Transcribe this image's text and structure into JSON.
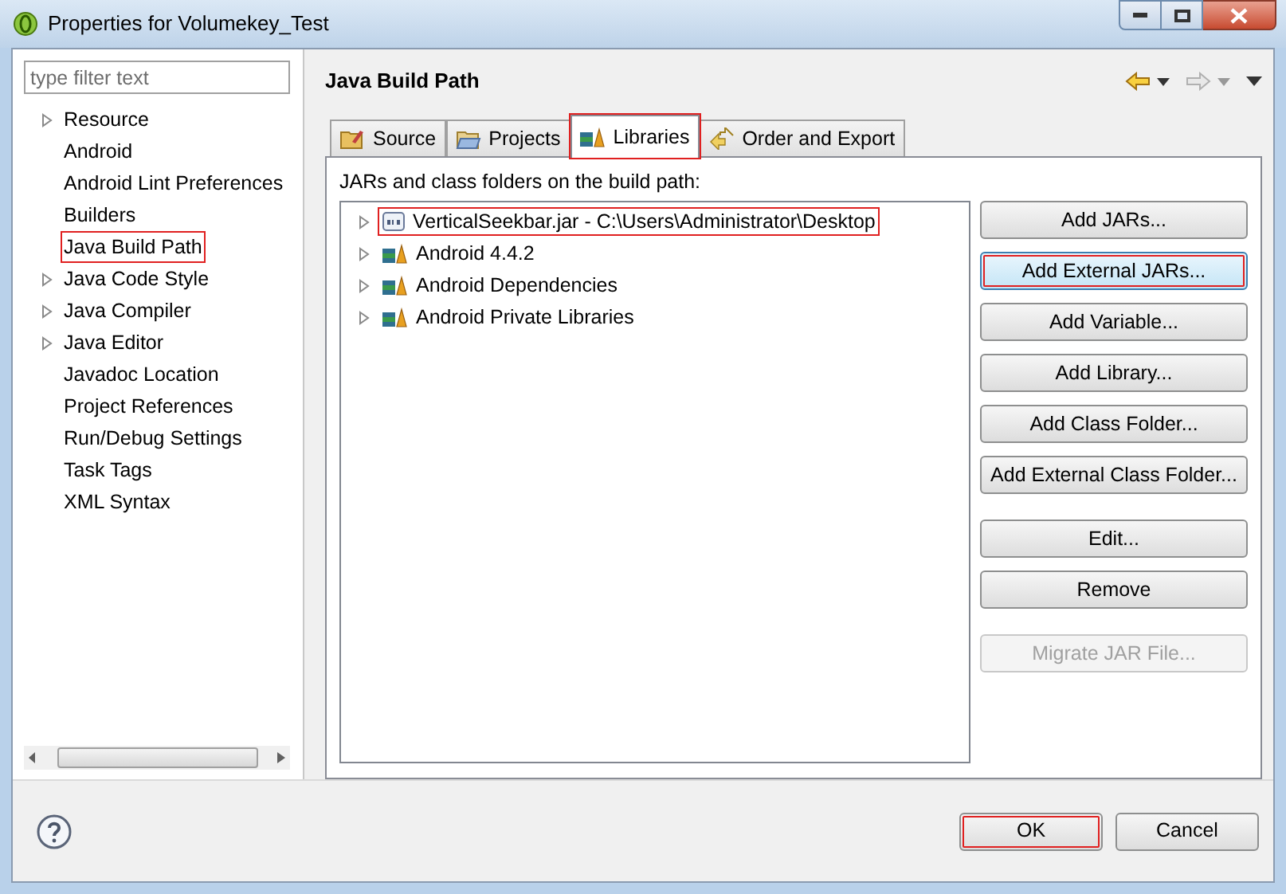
{
  "window": {
    "title": "Properties for Volumekey_Test"
  },
  "sidebar": {
    "filter": {
      "placeholder": "type filter text"
    },
    "items": [
      {
        "label": "Resource",
        "expandable": true,
        "highlighted": false
      },
      {
        "label": "Android",
        "expandable": false,
        "highlighted": false
      },
      {
        "label": "Android Lint Preferences",
        "expandable": false,
        "highlighted": false
      },
      {
        "label": "Builders",
        "expandable": false,
        "highlighted": false
      },
      {
        "label": "Java Build Path",
        "expandable": false,
        "highlighted": true
      },
      {
        "label": "Java Code Style",
        "expandable": true,
        "highlighted": false
      },
      {
        "label": "Java Compiler",
        "expandable": true,
        "highlighted": false
      },
      {
        "label": "Java Editor",
        "expandable": true,
        "highlighted": false
      },
      {
        "label": "Javadoc Location",
        "expandable": false,
        "highlighted": false
      },
      {
        "label": "Project References",
        "expandable": false,
        "highlighted": false
      },
      {
        "label": "Run/Debug Settings",
        "expandable": false,
        "highlighted": false
      },
      {
        "label": "Task Tags",
        "expandable": false,
        "highlighted": false
      },
      {
        "label": "XML Syntax",
        "expandable": false,
        "highlighted": false
      }
    ]
  },
  "page": {
    "title": "Java Build Path",
    "tabs": [
      {
        "label": "Source",
        "selected": false,
        "highlighted": false
      },
      {
        "label": "Projects",
        "selected": false,
        "highlighted": false
      },
      {
        "label": "Libraries",
        "selected": true,
        "highlighted": true
      },
      {
        "label": "Order and Export",
        "selected": false,
        "highlighted": false
      }
    ],
    "list_label": "JARs and class folders on the build path:",
    "entries": [
      {
        "label": "VerticalSeekbar.jar - C:\\Users\\Administrator\\Desktop",
        "kind": "jar",
        "highlighted": true
      },
      {
        "label": "Android 4.4.2",
        "kind": "library",
        "highlighted": false
      },
      {
        "label": "Android Dependencies",
        "kind": "library",
        "highlighted": false
      },
      {
        "label": "Android Private Libraries",
        "kind": "library",
        "highlighted": false
      }
    ],
    "button_groups": [
      [
        {
          "label": "Add JARs...",
          "disabled": false,
          "focused": false,
          "highlighted": false
        },
        {
          "label": "Add External JARs...",
          "disabled": false,
          "focused": true,
          "highlighted": true
        },
        {
          "label": "Add Variable...",
          "disabled": false,
          "focused": false,
          "highlighted": false
        },
        {
          "label": "Add Library...",
          "disabled": false,
          "focused": false,
          "highlighted": false
        },
        {
          "label": "Add Class Folder...",
          "disabled": false,
          "focused": false,
          "highlighted": false
        },
        {
          "label": "Add External Class Folder...",
          "disabled": false,
          "focused": false,
          "highlighted": false
        }
      ],
      [
        {
          "label": "Edit...",
          "disabled": false,
          "focused": false,
          "highlighted": false
        },
        {
          "label": "Remove",
          "disabled": false,
          "focused": false,
          "highlighted": false
        }
      ],
      [
        {
          "label": "Migrate JAR File...",
          "disabled": true,
          "focused": false,
          "highlighted": false
        }
      ]
    ]
  },
  "footer": {
    "buttons": [
      {
        "label": "OK",
        "highlighted": true
      },
      {
        "label": "Cancel",
        "highlighted": false
      }
    ]
  }
}
